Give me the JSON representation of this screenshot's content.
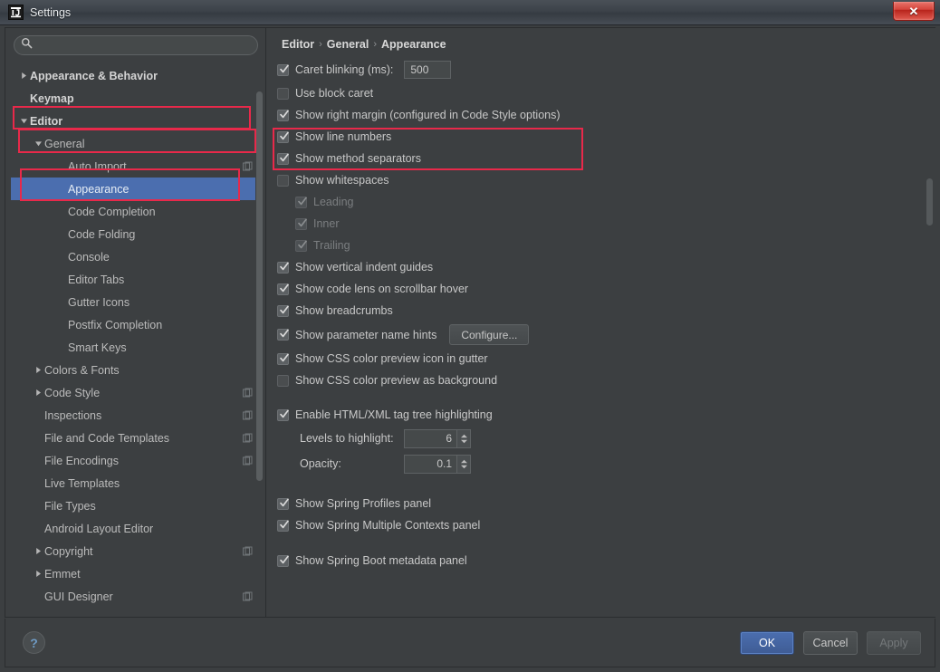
{
  "window": {
    "title": "Settings",
    "logo_icon": "intellij-idea-logo",
    "close_icon": "close-x-icon"
  },
  "sidebar": {
    "search": {
      "value": "",
      "placeholder": "",
      "icon": "search-icon"
    },
    "items": [
      {
        "label": "Appearance & Behavior",
        "indent": 0,
        "arrow": "collapsed",
        "bold": true,
        "selected": false,
        "icon": null
      },
      {
        "label": "Keymap",
        "indent": 0,
        "arrow": "none",
        "bold": true,
        "selected": false,
        "icon": null
      },
      {
        "label": "Editor",
        "indent": 0,
        "arrow": "expanded",
        "bold": true,
        "selected": false,
        "icon": null
      },
      {
        "label": "General",
        "indent": 1,
        "arrow": "expanded",
        "bold": false,
        "selected": false,
        "icon": null
      },
      {
        "label": "Auto Import",
        "indent": 2,
        "arrow": "none",
        "bold": false,
        "selected": false,
        "icon": "copy-scope-icon"
      },
      {
        "label": "Appearance",
        "indent": 2,
        "arrow": "none",
        "bold": false,
        "selected": true,
        "icon": null
      },
      {
        "label": "Code Completion",
        "indent": 2,
        "arrow": "none",
        "bold": false,
        "selected": false,
        "icon": null
      },
      {
        "label": "Code Folding",
        "indent": 2,
        "arrow": "none",
        "bold": false,
        "selected": false,
        "icon": null
      },
      {
        "label": "Console",
        "indent": 2,
        "arrow": "none",
        "bold": false,
        "selected": false,
        "icon": null
      },
      {
        "label": "Editor Tabs",
        "indent": 2,
        "arrow": "none",
        "bold": false,
        "selected": false,
        "icon": null
      },
      {
        "label": "Gutter Icons",
        "indent": 2,
        "arrow": "none",
        "bold": false,
        "selected": false,
        "icon": null
      },
      {
        "label": "Postfix Completion",
        "indent": 2,
        "arrow": "none",
        "bold": false,
        "selected": false,
        "icon": null
      },
      {
        "label": "Smart Keys",
        "indent": 2,
        "arrow": "none",
        "bold": false,
        "selected": false,
        "icon": null
      },
      {
        "label": "Colors & Fonts",
        "indent": 1,
        "arrow": "collapsed",
        "bold": false,
        "selected": false,
        "icon": null
      },
      {
        "label": "Code Style",
        "indent": 1,
        "arrow": "collapsed",
        "bold": false,
        "selected": false,
        "icon": "copy-scope-icon"
      },
      {
        "label": "Inspections",
        "indent": 1,
        "arrow": "none",
        "bold": false,
        "selected": false,
        "icon": "copy-scope-icon"
      },
      {
        "label": "File and Code Templates",
        "indent": 1,
        "arrow": "none",
        "bold": false,
        "selected": false,
        "icon": "copy-scope-icon"
      },
      {
        "label": "File Encodings",
        "indent": 1,
        "arrow": "none",
        "bold": false,
        "selected": false,
        "icon": "copy-scope-icon"
      },
      {
        "label": "Live Templates",
        "indent": 1,
        "arrow": "none",
        "bold": false,
        "selected": false,
        "icon": null
      },
      {
        "label": "File Types",
        "indent": 1,
        "arrow": "none",
        "bold": false,
        "selected": false,
        "icon": null
      },
      {
        "label": "Android Layout Editor",
        "indent": 1,
        "arrow": "none",
        "bold": false,
        "selected": false,
        "icon": null
      },
      {
        "label": "Copyright",
        "indent": 1,
        "arrow": "collapsed",
        "bold": false,
        "selected": false,
        "icon": "copy-scope-icon"
      },
      {
        "label": "Emmet",
        "indent": 1,
        "arrow": "collapsed",
        "bold": false,
        "selected": false,
        "icon": null
      },
      {
        "label": "GUI Designer",
        "indent": 1,
        "arrow": "none",
        "bold": false,
        "selected": false,
        "icon": "copy-scope-icon"
      }
    ]
  },
  "main": {
    "breadcrumb": {
      "part1": "Editor",
      "sep1": "›",
      "part2": "General",
      "sep2": "›",
      "part3": "Appearance"
    },
    "options": {
      "caret_blinking": {
        "label": "Caret blinking (ms):",
        "checked": true,
        "value": "500"
      },
      "use_block_caret": {
        "label": "Use block caret",
        "checked": false
      },
      "show_right_margin": {
        "label": "Show right margin (configured in Code Style options)",
        "checked": true
      },
      "show_line_numbers": {
        "label": "Show line numbers",
        "checked": true
      },
      "show_method_separators": {
        "label": "Show method separators",
        "checked": true
      },
      "show_whitespaces": {
        "label": "Show whitespaces",
        "checked": false
      },
      "ws_leading": {
        "label": "Leading",
        "checked": true,
        "disabled": true
      },
      "ws_inner": {
        "label": "Inner",
        "checked": true,
        "disabled": true
      },
      "ws_trailing": {
        "label": "Trailing",
        "checked": true,
        "disabled": true
      },
      "show_vertical_indent_guides": {
        "label": "Show vertical indent guides",
        "checked": true
      },
      "show_code_lens": {
        "label": "Show code lens on scrollbar hover",
        "checked": true
      },
      "show_breadcrumbs": {
        "label": "Show breadcrumbs",
        "checked": true
      },
      "show_parameter_name_hints": {
        "label": "Show parameter name hints",
        "checked": true,
        "button": "Configure..."
      },
      "show_css_gutter": {
        "label": "Show CSS color preview icon in gutter",
        "checked": true
      },
      "show_css_background": {
        "label": "Show CSS color preview as background",
        "checked": false
      },
      "enable_tag_tree": {
        "label": "Enable HTML/XML tag tree highlighting",
        "checked": true
      },
      "levels_to_highlight": {
        "label": "Levels to highlight:",
        "value": "6"
      },
      "opacity": {
        "label": "Opacity:",
        "value": "0.1"
      },
      "spring_profiles": {
        "label": "Show Spring Profiles panel",
        "checked": true
      },
      "spring_multiple_contexts": {
        "label": "Show Spring Multiple Contexts panel",
        "checked": true
      },
      "spring_boot_metadata": {
        "label": "Show Spring Boot metadata panel",
        "checked": true
      }
    }
  },
  "footer": {
    "help_icon": "help-question-icon",
    "ok": "OK",
    "cancel": "Cancel",
    "apply": "Apply"
  },
  "colors": {
    "window_bg": "#3c3f41",
    "selection_blue": "#4b6eaf",
    "annotation_red": "#e8294a",
    "text": "#c8c8c8",
    "text_disabled": "#7b7e80"
  }
}
